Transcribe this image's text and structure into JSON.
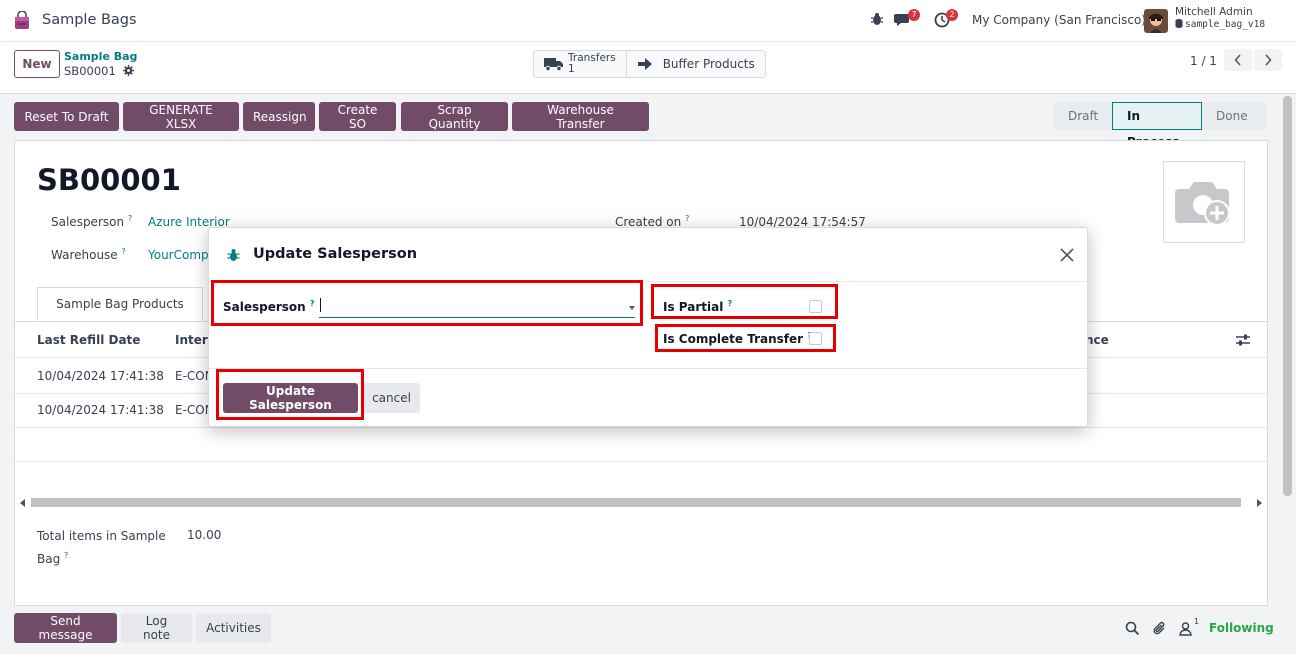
{
  "navbar": {
    "app_title": "Sample Bags",
    "messages_count": "7",
    "activities_count": "2",
    "company": "My Company (San Francisco)",
    "user_name": "Mitchell Admin",
    "database": "sample_bag_v18"
  },
  "control": {
    "new_label": "New",
    "breadcrumb_parent": "Sample Bag",
    "breadcrumb_current": "SB00001",
    "smart_transfers_label": "Transfers",
    "smart_transfers_count": "1",
    "smart_buffer_label": "Buffer Products",
    "pager": "1 / 1"
  },
  "actions": {
    "reset": "Reset To Draft",
    "xlsx": "GENERATE XLSX",
    "reassign": "Reassign",
    "create_so": "Create SO",
    "scrap": "Scrap Quantity",
    "warehouse": "Warehouse Transfer"
  },
  "status": {
    "stages": [
      "Draft",
      "In Process",
      "Done"
    ],
    "active": "In Process"
  },
  "record": {
    "title": "SB00001",
    "salesperson_label": "Salesperson",
    "salesperson_value": "Azure Interior",
    "warehouse_label": "Warehouse",
    "warehouse_value": "YourComp",
    "created_label": "Created on",
    "created_value": "10/04/2024 17:54:57",
    "help_mark": "?"
  },
  "tabs": {
    "products": "Sample Bag Products"
  },
  "table": {
    "headers": [
      "Last Refill Date",
      "Intern",
      "nce"
    ],
    "rows": [
      [
        "10/04/2024 17:41:38",
        "E-CON"
      ],
      [
        "10/04/2024 17:41:38",
        "E-CON"
      ]
    ]
  },
  "totals": {
    "label_line1": "Total items in Sample",
    "label_line2": "Bag",
    "value": "10.00"
  },
  "chatter": {
    "send": "Send message",
    "log": "Log note",
    "activities": "Activities",
    "followers_count": "1",
    "following": "Following"
  },
  "modal": {
    "title": "Update Salesperson",
    "salesperson_label": "Salesperson",
    "salesperson_value": "",
    "is_partial_label": "Is Partial",
    "is_complete_label": "Is Complete Transfer",
    "update_button": "Update Salesperson",
    "cancel_button": "cancel"
  },
  "colors": {
    "brand": "#714b67",
    "link": "#017e84",
    "highlight": "#e60000",
    "following": "#28a745"
  }
}
